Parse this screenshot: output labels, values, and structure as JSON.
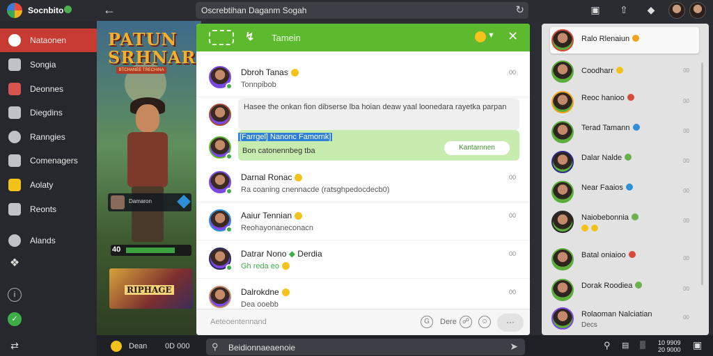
{
  "app": {
    "title": "Socnbito"
  },
  "search_top": {
    "value": "Oscrebtihan Daganm Sogah"
  },
  "sidebar": {
    "items": [
      {
        "label": "Nataonen",
        "active": true
      },
      {
        "label": "Songia"
      },
      {
        "label": "Deonnes"
      },
      {
        "label": "Diegdins"
      },
      {
        "label": "Ranngies"
      },
      {
        "label": "Comenagers"
      },
      {
        "label": "Aolaty"
      },
      {
        "label": "Reonts"
      },
      {
        "label": "Alands"
      }
    ]
  },
  "game": {
    "title_line1": "PATUN",
    "title_line2": "SRHNAR",
    "subtitle": "BTCHANEE TRECHINA",
    "card_text": "Damaron",
    "hp_value": "40",
    "level_art_text": "RIPHAGE"
  },
  "chat": {
    "header_title": "Tamein",
    "messages": [
      {
        "name": "Dbroh Tanas",
        "preview": "Tonnpibob",
        "time": "00"
      },
      {
        "name": "",
        "bubble": "Hasee the onkan fion dibserse lba hoian deaw yaal loonedara rayetka parpan"
      },
      {
        "name": "[Farrgel] Nanonc Famornk]",
        "preview": "Bon catonennbeg tba",
        "button": "Kantarnnen",
        "highlight": true
      },
      {
        "name": "Darnal Ronac",
        "preview": "Ra coaning cnennacde (ratsghpedocdecb0)",
        "time": "00"
      },
      {
        "name": "Aaiur Tennian",
        "preview": "Reohayonaneconacn",
        "time": "00"
      },
      {
        "name": "Datrar Nono",
        "name_suffix": "Derdia",
        "preview": "Gh reda eo",
        "time": "00"
      },
      {
        "name": "Dalrokdne",
        "preview": "Dea ooebb",
        "time": "00"
      }
    ],
    "composer": {
      "placeholder": "Aeteoentennand",
      "dere_label": "Dere",
      "more": "···"
    }
  },
  "contacts": [
    {
      "name": "Ralo Rlenaiun",
      "top": true
    },
    {
      "name": "Coodharr",
      "status_color": "#f2c21b",
      "time": "00"
    },
    {
      "name": "Reoc hanioo",
      "status_color": "#d64a3a",
      "time": "00"
    },
    {
      "name": "Terad Tamann",
      "status_color": "#2f8fd6",
      "time": "00"
    },
    {
      "name": "Dalar Nalde",
      "status_color": "#6ab04c",
      "time": "00"
    },
    {
      "name": "Near Faaios",
      "status_color": "#2f8fd6",
      "time": "00"
    },
    {
      "name": "Naiobebonnia",
      "status_color": "#6ab04c",
      "sub": "",
      "time": "00"
    },
    {
      "name": "Batal oniaioo",
      "status_color": "#d64a3a",
      "time": "00"
    },
    {
      "name": "Dorak Roodiea",
      "status_color": "#6ab04c",
      "time": "00"
    },
    {
      "name": "Rolaoman Nalciatian",
      "sub": "Decs",
      "time": "00"
    }
  ],
  "bottom": {
    "left_label": "Dean",
    "count_label": "0D 000",
    "search_value": "Beidionnaeaenoie",
    "clock_time": "10 9909",
    "clock_date": "20 9000"
  },
  "colors": {
    "accent_green": "#5dba2f",
    "active_red": "#c83b33",
    "online": "#3fae49"
  }
}
